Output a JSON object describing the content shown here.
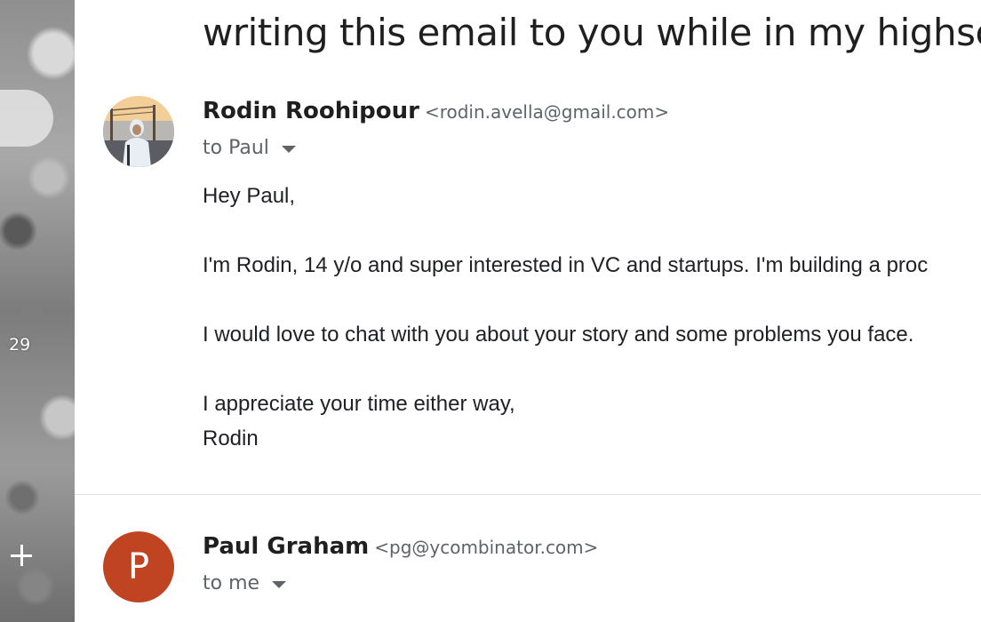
{
  "subject": "writing this email to you while in my highscho",
  "rail": {
    "count": "29",
    "compose_icon": "plus-icon"
  },
  "messages": [
    {
      "sender_name": "Rodin Roohipour",
      "sender_email": "<rodin.avella@gmail.com>",
      "recipient": "to Paul",
      "avatar_type": "photo",
      "body": [
        "Hey Paul,",
        "I'm Rodin, 14 y/o and super interested in VC and startups. I'm building a proc",
        "I would love to chat with you about your story and some problems you face.",
        "I appreciate your time either way,",
        "Rodin"
      ]
    },
    {
      "sender_name": "Paul Graham",
      "sender_email": "<pg@ycombinator.com>",
      "recipient": "to me",
      "avatar_letter": "P",
      "avatar_color": "#c04422"
    }
  ]
}
